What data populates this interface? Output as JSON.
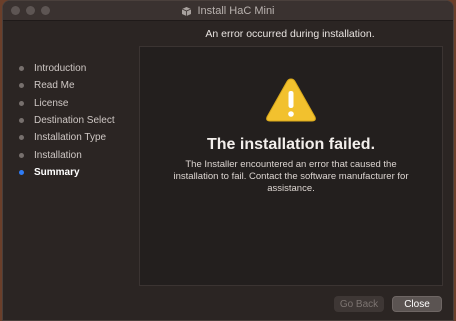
{
  "window": {
    "title": "Install HaC Mini"
  },
  "header": {
    "message": "An error occurred during installation."
  },
  "sidebar": {
    "steps": [
      {
        "label": "Introduction",
        "current": false
      },
      {
        "label": "Read Me",
        "current": false
      },
      {
        "label": "License",
        "current": false
      },
      {
        "label": "Destination Select",
        "current": false
      },
      {
        "label": "Installation Type",
        "current": false
      },
      {
        "label": "Installation",
        "current": false
      },
      {
        "label": "Summary",
        "current": true
      }
    ]
  },
  "panel": {
    "icon": "warning-icon",
    "title": "The installation failed.",
    "message": "The Installer encountered an error that caused the installation to fail. Contact the software manufacturer for assistance."
  },
  "buttons": {
    "back_label": "Go Back",
    "close_label": "Close"
  },
  "colors": {
    "accent": "#2f7cf6",
    "warning": "#f2c12e"
  }
}
